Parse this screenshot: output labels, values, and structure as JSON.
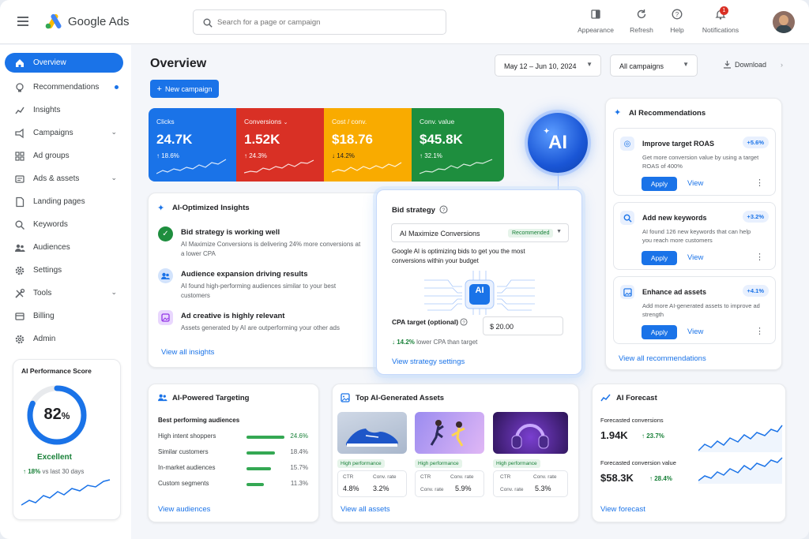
{
  "app": {
    "name": "Google Ads"
  },
  "search": {
    "placeholder": "Search for a page or campaign"
  },
  "topbar": {
    "appearance": "Appearance",
    "refresh": "Refresh",
    "help": "Help",
    "notifications": "Notifications",
    "notif_count": "1"
  },
  "sidebar": {
    "items": [
      {
        "label": "Overview"
      },
      {
        "label": "Recommendations"
      },
      {
        "label": "Insights"
      },
      {
        "label": "Campaigns"
      },
      {
        "label": "Ad groups"
      },
      {
        "label": "Ads & assets"
      },
      {
        "label": "Landing pages"
      },
      {
        "label": "Keywords"
      },
      {
        "label": "Audiences"
      },
      {
        "label": "Settings"
      },
      {
        "label": "Tools"
      },
      {
        "label": "Billing"
      },
      {
        "label": "Admin"
      }
    ]
  },
  "score": {
    "title": "AI Performance Score",
    "value": "82",
    "unit": "%",
    "fraction": 0.82,
    "label": "Excellent",
    "change": "18%",
    "change_text": "vs last 30 days"
  },
  "header": {
    "title": "Overview",
    "date_range": "May 12 – Jun 10, 2024",
    "campaign_filter": "All campaigns",
    "download": "Download",
    "new_campaign": "New campaign"
  },
  "kpis": [
    {
      "label": "Clicks",
      "value": "24.7K",
      "change": "18.6%",
      "color": "#1a73e8"
    },
    {
      "label": "Conversions",
      "value": "1.52K",
      "change": "24.3%",
      "color": "#d93025"
    },
    {
      "label": "Cost / conv.",
      "value": "$18.76",
      "change": "14.2%",
      "color": "#f9ab00"
    },
    {
      "label": "Conv. value",
      "value": "$45.8K",
      "change": "32.1%",
      "color": "#1e8e3e"
    }
  ],
  "ai_badge": "AI",
  "insights": {
    "title": "AI-Optimized Insights",
    "items": [
      {
        "title": "Bid strategy is working well",
        "desc": "AI Maximize Conversions is delivering 24% more conversions at a lower CPA"
      },
      {
        "title": "Audience expansion driving results",
        "desc": "AI found high-performing audiences similar to your best customers"
      },
      {
        "title": "Ad creative is highly relevant",
        "desc": "Assets generated by AI are outperforming your other ads"
      }
    ],
    "link": "View all insights"
  },
  "bid": {
    "title": "Bid strategy",
    "strategy": "AI Maximize Conversions",
    "badge": "Recommended",
    "desc": "Google AI is optimizing bids to get you the most conversions within your budget",
    "chip": "AI",
    "cpa_label": "CPA target (optional)",
    "cpa_value": "$ 20.00",
    "change": "14.2%",
    "change_text": "lower CPA than target",
    "link": "View strategy settings"
  },
  "recs": {
    "title": "AI Recommendations",
    "items": [
      {
        "title": "Improve target ROAS",
        "pct": "+5.6%",
        "desc": "Get more conversion value by using a target ROAS of 400%"
      },
      {
        "title": "Add new keywords",
        "pct": "+3.2%",
        "desc": "AI found 126 new keywords that can help you reach more customers"
      },
      {
        "title": "Enhance ad assets",
        "pct": "+4.1%",
        "desc": "Add more AI-generated assets to improve ad strength"
      }
    ],
    "apply": "Apply",
    "view": "View",
    "link": "View all recommendations"
  },
  "targeting": {
    "title": "AI-Powered Targeting",
    "subtitle": "Best performing audiences",
    "rows": [
      {
        "name": "High intent shoppers",
        "pct": "24.6%",
        "value": 24.6
      },
      {
        "name": "Similar customers",
        "pct": "18.4%",
        "value": 18.4
      },
      {
        "name": "In-market audiences",
        "pct": "15.7%",
        "value": 15.7
      },
      {
        "name": "Custom segments",
        "pct": "11.3%",
        "value": 11.3
      }
    ],
    "link": "View audiences"
  },
  "assets": {
    "title": "Top AI-Generated Assets",
    "badge": "High performance",
    "ctr_label": "CTR",
    "conv_label": "Conv. rate",
    "items": [
      {
        "ctr": "4.8%",
        "conv": "3.2%"
      },
      {
        "ctr": "",
        "conv": "5.9%"
      },
      {
        "ctr": "",
        "conv": "5.3%"
      }
    ],
    "link": "View all assets"
  },
  "forecast": {
    "title": "AI Forecast",
    "conv_label": "Forecasted conversions",
    "conv_value": "1.94K",
    "conv_change": "23.7%",
    "value_label": "Forecasted conversion value",
    "value_value": "$58.3K",
    "value_change": "28.4%",
    "link": "View forecast"
  }
}
